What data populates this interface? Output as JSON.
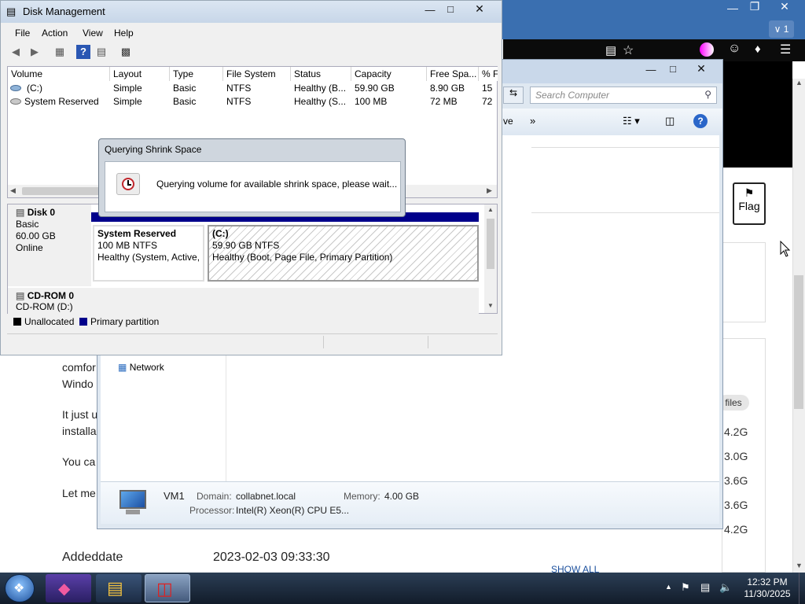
{
  "browser": {
    "tab_count": "1",
    "flag_label": "Flag",
    "files_badge": "files",
    "sizes": [
      "4.2G",
      "3.0G",
      "3.6G",
      "3.6G",
      "4.2G"
    ],
    "show_all": "SHOW ALL",
    "bg_text": {
      "line1": "comfor",
      "line2": "Windo",
      "line3": "It just u",
      "line4": "installa",
      "line5": "You ca",
      "line6": "Let me",
      "meta_key": "Addeddate",
      "meta_value": "2023-02-03 09:33:30"
    }
  },
  "explorer": {
    "search_placeholder": "Search Computer",
    "toolbar_more": "ve",
    "nav_network": "Network",
    "details": {
      "name": "VM1",
      "domain_label": "Domain:",
      "domain_value": "collabnet.local",
      "memory_label": "Memory:",
      "memory_value": "4.00 GB",
      "processor_label": "Processor:",
      "processor_value": "Intel(R) Xeon(R) CPU E5..."
    }
  },
  "disk_management": {
    "title": "Disk Management",
    "menu": [
      "File",
      "Action",
      "View",
      "Help"
    ],
    "columns": [
      "Volume",
      "Layout",
      "Type",
      "File System",
      "Status",
      "Capacity",
      "Free Spa...",
      "% F"
    ],
    "rows": [
      [
        "(C:)",
        "Simple",
        "Basic",
        "NTFS",
        "Healthy (B...",
        "59.90 GB",
        "8.90 GB",
        "15"
      ],
      [
        "System Reserved",
        "Simple",
        "Basic",
        "NTFS",
        "Healthy (S...",
        "100 MB",
        "72 MB",
        "72"
      ]
    ],
    "disks": {
      "disk0_name": "Disk 0",
      "disk0_type": "Basic",
      "disk0_size": "60.00 GB",
      "disk0_state": "Online",
      "cdrom_name": "CD-ROM 0",
      "cdrom_drive": "CD-ROM (D:)"
    },
    "partitions": {
      "p1_title": "System Reserved",
      "p1_size": "100 MB NTFS",
      "p1_status": "Healthy (System, Active,",
      "p2_title": "(C:)",
      "p2_size": "59.90 GB NTFS",
      "p2_status": "Healthy (Boot, Page File, Primary Partition)"
    },
    "legend": {
      "unallocated": "Unallocated",
      "primary": "Primary partition"
    }
  },
  "dialog": {
    "title": "Querying Shrink Space",
    "message": "Querying volume for available shrink space, please wait..."
  },
  "taskbar": {
    "time": "12:32 PM",
    "date": "11/30/2025"
  },
  "colors": {
    "primary_partition": "#00008b",
    "unallocated": "#000000",
    "taskbar": "#1a2638"
  }
}
